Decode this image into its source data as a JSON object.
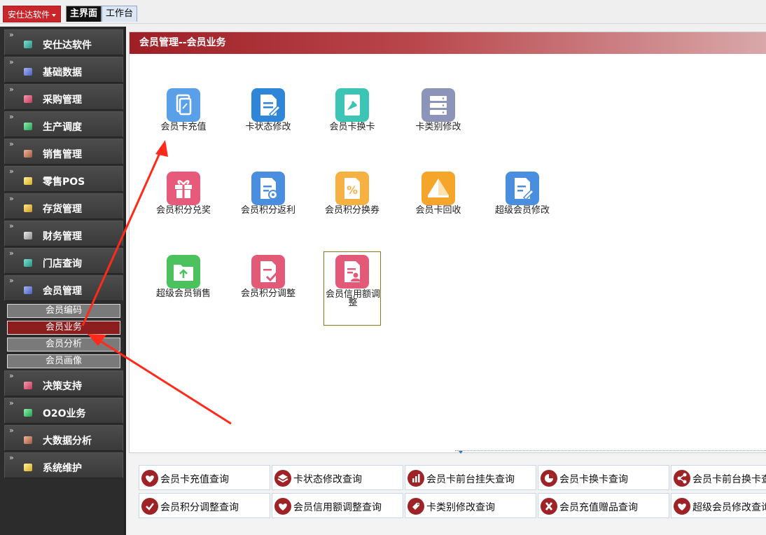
{
  "topbar": {
    "brand": "安仕达软件",
    "tabs": [
      {
        "label": "主界面",
        "active": true
      },
      {
        "label": "工作台",
        "active": false
      }
    ]
  },
  "sidebar": {
    "items": [
      {
        "label": "安仕达软件",
        "icon": "teal-cube-icon",
        "color": "#3fb6a8"
      },
      {
        "label": "基础数据",
        "icon": "blue-cube-icon",
        "color": "#6a7fd8"
      },
      {
        "label": "采购管理",
        "icon": "red-cube-icon",
        "color": "#e0506a"
      },
      {
        "label": "生产调度",
        "icon": "green-cube-icon",
        "color": "#38c968"
      },
      {
        "label": "销售管理",
        "icon": "brown-cube-icon",
        "color": "#c97a5a"
      },
      {
        "label": "零售POS",
        "icon": "yellow-cube-icon",
        "color": "#f2d34a"
      },
      {
        "label": "存货管理",
        "icon": "yellow-cube-icon",
        "color": "#f2c84a"
      },
      {
        "label": "财务管理",
        "icon": "gray-cube-icon",
        "color": "#bdbdbd"
      },
      {
        "label": "门店查询",
        "icon": "teal-cube-icon",
        "color": "#3fb6a8"
      },
      {
        "label": "会员管理",
        "icon": "blue-cube-icon",
        "color": "#6a7fd8"
      },
      {
        "label": "决策支持",
        "icon": "red-cube-icon",
        "color": "#e0506a"
      },
      {
        "label": "O2O业务",
        "icon": "green-cube-icon",
        "color": "#38c968"
      },
      {
        "label": "大数据分析",
        "icon": "brown-cube-icon",
        "color": "#c97a5a"
      },
      {
        "label": "系统维护",
        "icon": "yellow-cube-icon",
        "color": "#f2d34a"
      }
    ],
    "sub_items": [
      {
        "label": "会员编码",
        "active": false
      },
      {
        "label": "会员业务",
        "active": true
      },
      {
        "label": "会员分析",
        "active": false
      },
      {
        "label": "会员画像",
        "active": false
      }
    ]
  },
  "main": {
    "title": "会员管理--会员业务",
    "functions": [
      {
        "label": "会员卡充值",
        "icon": "card-recharge-icon",
        "color": "#5aa0e8"
      },
      {
        "label": "卡状态修改",
        "icon": "document-edit-icon",
        "color": "#2f86d8"
      },
      {
        "label": "会员卡换卡",
        "icon": "pin-card-icon",
        "color": "#3cc4b4"
      },
      {
        "label": "卡类别修改",
        "icon": "server-stack-icon",
        "color": "#8c94ba"
      },
      {
        "label": "会员积分兑奖",
        "icon": "gift-icon",
        "color": "#e85a7a"
      },
      {
        "label": "会员积分返利",
        "icon": "document-gear-icon",
        "color": "#4a8ee0"
      },
      {
        "label": "会员积分换券",
        "icon": "percent-coupon-icon",
        "color": "#f5b142"
      },
      {
        "label": "会员卡回收",
        "icon": "pyramid-icon",
        "color": "#f5a52a"
      },
      {
        "label": "超级会员修改",
        "icon": "document-pen-icon",
        "color": "#4a8ee0"
      },
      {
        "label": "超级会员销售",
        "icon": "folder-upload-icon",
        "color": "#4cc25e"
      },
      {
        "label": "会员积分调整",
        "icon": "document-check-icon",
        "color": "#e25a78"
      },
      {
        "label": "会员信用额调整",
        "icon": "document-user-icon",
        "color": "#e25a78"
      }
    ]
  },
  "queries": [
    {
      "label": "会员卡充值查询",
      "icon": "heart-card-icon"
    },
    {
      "label": "卡状态修改查询",
      "icon": "layers-icon"
    },
    {
      "label": "会员卡前台挂失查询",
      "icon": "bar-chart-icon"
    },
    {
      "label": "会员卡换卡查询",
      "icon": "pie-chart-icon"
    },
    {
      "label": "会员卡前台换卡查",
      "icon": "network-icon"
    },
    {
      "label": "会员积分调整查询",
      "icon": "check-icon"
    },
    {
      "label": "会员信用额调整查询",
      "icon": "heart-card-icon"
    },
    {
      "label": "卡类别修改查询",
      "icon": "tag-icon"
    },
    {
      "label": "会员充值赠品查询",
      "icon": "x-icon"
    },
    {
      "label": "超级会员修改查询",
      "icon": "heart-card-icon"
    }
  ]
}
